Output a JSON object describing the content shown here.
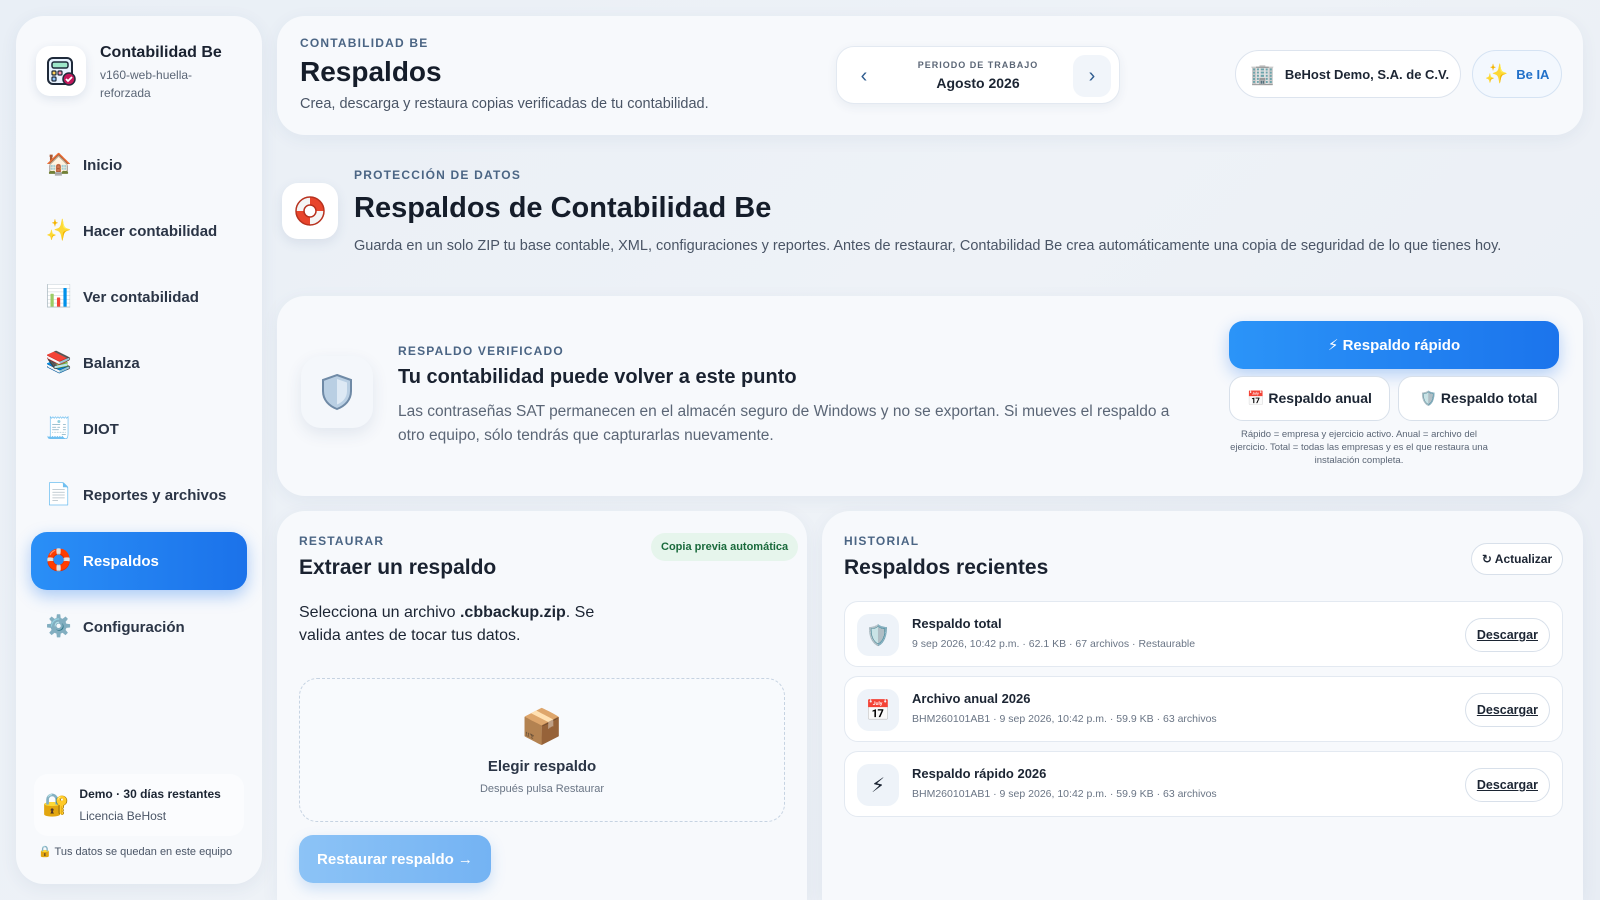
{
  "sidebar": {
    "brand_title": "Contabilidad Be",
    "brand_sub": "v160-web-huella-reforzada",
    "items": [
      {
        "label": "Inicio",
        "icon": "home-icon",
        "glyph": "🏠"
      },
      {
        "label": "Hacer contabilidad",
        "icon": "sparkles-icon",
        "glyph": "✨"
      },
      {
        "label": "Ver contabilidad",
        "icon": "bar-chart-icon",
        "glyph": "📊"
      },
      {
        "label": "Balanza",
        "icon": "books-icon",
        "glyph": "📚"
      },
      {
        "label": "DIOT",
        "icon": "receipt-icon",
        "glyph": "🧾"
      },
      {
        "label": "Reportes y archivos",
        "icon": "document-icon",
        "glyph": "📄"
      },
      {
        "label": "Respaldos",
        "icon": "lifebuoy-icon",
        "glyph": "🛟"
      },
      {
        "label": "Configuración",
        "icon": "gear-icon",
        "glyph": "⚙️"
      }
    ],
    "active_index": 6,
    "license_title": "Demo · 30 días restantes",
    "license_sub": "Licencia BeHost",
    "privacy": "🔒 Tus datos se quedan en este equipo"
  },
  "header": {
    "eyebrow": "CONTABILIDAD BE",
    "title": "Respaldos",
    "desc": "Crea, descarga y restaura copias verificadas de tu contabilidad.",
    "period_caption": "PERIODO DE TRABAJO",
    "period_value": "Agosto 2026",
    "company": "BeHost Demo, S.A. de C.V.",
    "ai_label": "Be IA"
  },
  "section": {
    "eyebrow": "PROTECCIÓN DE DATOS",
    "title": "Respaldos de Contabilidad Be",
    "desc": "Guarda en un solo ZIP tu base contable, XML, configuraciones y reportes. Antes de restaurar, Contabilidad Be crea automáticamente una copia de seguridad de lo que tienes hoy."
  },
  "verified": {
    "eyebrow": "RESPALDO VERIFICADO",
    "title": "Tu contabilidad puede volver a este punto",
    "text": "Las contraseñas SAT permanecen en el almacén seguro de Windows y no se exportan. Si mueves el respaldo a otro equipo, sólo tendrás que capturarlas nuevamente.",
    "quick_label": "⚡ Respaldo rápido",
    "annual_label": "📅 Respaldo anual",
    "total_label": "🛡️ Respaldo total",
    "hint": "Rápido = empresa y ejercicio activo. Anual = archivo del ejercicio. Total = todas las empresas y es el que restaura una instalación completa."
  },
  "restore": {
    "eyebrow": "RESTAURAR",
    "title": "Extraer un respaldo",
    "badge": "Copia previa automática",
    "inst_pre": "Selecciona un archivo ",
    "inst_file": ".cbbackup.zip",
    "inst_post": ". Se valida antes de tocar tus datos.",
    "drop_title": "Elegir respaldo",
    "drop_sub": "Después pulsa Restaurar",
    "button": "Restaurar respaldo →"
  },
  "history": {
    "eyebrow": "HISTORIAL",
    "title": "Respaldos recientes",
    "refresh": "↻ Actualizar",
    "rows": [
      {
        "name": "Respaldo total",
        "meta": "9 sep 2026, 10:42 p.m. · 62.1 KB · 67 archivos · Restaurable",
        "glyph": "🛡️",
        "icon": "shield-icon",
        "action": "Descargar"
      },
      {
        "name": "Archivo anual 2026",
        "meta": "BHM260101AB1 · 9 sep 2026, 10:42 p.m. · 59.9 KB · 63 archivos",
        "glyph": "📅",
        "icon": "calendar-icon",
        "action": "Descargar"
      },
      {
        "name": "Respaldo rápido 2026",
        "meta": "BHM260101AB1 · 9 sep 2026, 10:42 p.m. · 59.9 KB · 63 archivos",
        "glyph": "⚡",
        "icon": "lightning-icon",
        "action": "Descargar"
      }
    ]
  },
  "colors": {
    "accent": "#1b72ea",
    "background": "#e9eff6",
    "badge_bg": "#e6f5ec",
    "badge_text": "#1a6a3c"
  }
}
